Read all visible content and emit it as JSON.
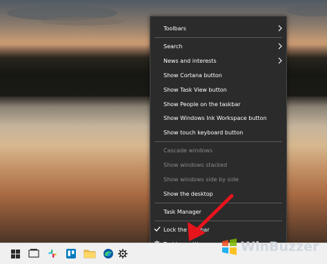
{
  "menu": {
    "items": [
      {
        "label": "Toolbars",
        "submenu": true
      },
      {
        "label": "Search",
        "submenu": true
      },
      {
        "label": "News and interests",
        "submenu": true
      },
      {
        "label": "Show Cortana button"
      },
      {
        "label": "Show Task View button"
      },
      {
        "label": "Show People on the taskbar"
      },
      {
        "label": "Show Windows Ink Workspace button"
      },
      {
        "label": "Show touch keyboard button"
      },
      {
        "label": "Cascade windows",
        "disabled": true
      },
      {
        "label": "Show windows stacked",
        "disabled": true
      },
      {
        "label": "Show windows side by side",
        "disabled": true
      },
      {
        "label": "Show the desktop"
      },
      {
        "label": "Task Manager"
      },
      {
        "label": "Lock the taskbar",
        "checked": true
      },
      {
        "label": "Taskbar settings",
        "icon": "gear-icon"
      }
    ]
  },
  "taskbar": {
    "icons": [
      "windows-start-icon",
      "file-explorer-icon",
      "slack-icon",
      "trello-icon",
      "folder-icon",
      "edge-icon",
      "settings-gear-icon"
    ]
  },
  "watermark": {
    "text": "WinBuzzer"
  },
  "colors": {
    "menu_bg": "#2b2b2b",
    "annotation": "#e8141c",
    "taskbar": "#f0f0f0"
  }
}
